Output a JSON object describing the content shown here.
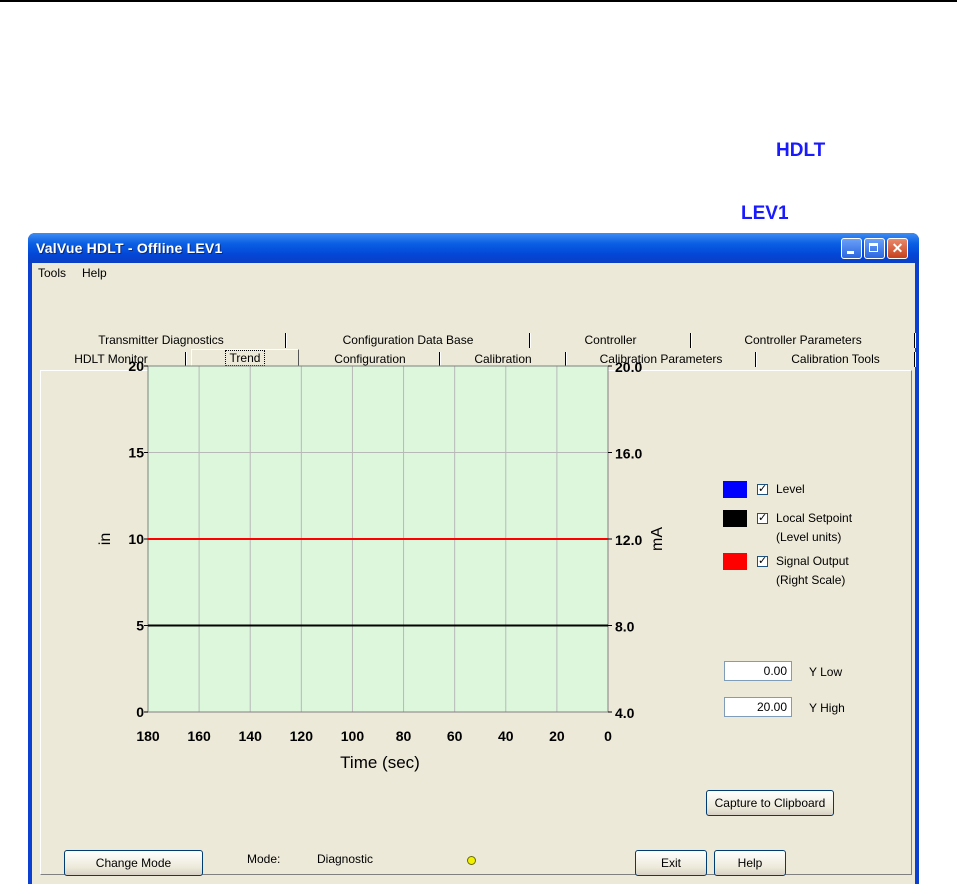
{
  "window": {
    "title": "ValVue HDLT - Offline  LEV1"
  },
  "menu": [
    "Tools",
    "Help"
  ],
  "tabs": {
    "row_back": [
      "Transmitter Diagnostics",
      "Configuration Data Base",
      "Controller",
      "Controller Parameters"
    ],
    "row_front": [
      "HDLT Monitor",
      "Trend",
      "Configuration",
      "Calibration",
      "Calibration Parameters",
      "Calibration Tools"
    ],
    "active": "Trend"
  },
  "chart_data": {
    "type": "line",
    "x": [
      180,
      160,
      140,
      120,
      100,
      80,
      60,
      40,
      20,
      0
    ],
    "xlabel": "Time (sec)",
    "ylabel": "in",
    "ylim": [
      0,
      20
    ],
    "y_ticks": [
      0,
      5,
      10,
      15,
      20
    ],
    "y2label": "mA",
    "y2lim": [
      4.0,
      20.0
    ],
    "y2_ticks": [
      "4.0",
      "8.0",
      "12.0",
      "16.0",
      "20.0"
    ],
    "grid": true,
    "background": "#ddf7dd",
    "series": [
      {
        "name": "Local Setpoint (Level units)",
        "axis": "left",
        "color": "#000000",
        "values": [
          5,
          5,
          5,
          5,
          5,
          5,
          5,
          5,
          5,
          5
        ]
      },
      {
        "name": "Signal Output (Right Scale)",
        "axis": "right",
        "color": "#ff0000",
        "values": [
          12.0,
          12.0,
          12.0,
          12.0,
          12.0,
          12.0,
          12.0,
          12.0,
          12.0,
          12.0
        ]
      }
    ]
  },
  "side": {
    "device_type": "HDLT",
    "tag": "LEV1",
    "legend": [
      {
        "color": "#0000ff",
        "checked": true,
        "line1": "Level",
        "line2": ""
      },
      {
        "color": "#000000",
        "checked": true,
        "line1": "Local Setpoint",
        "line2": "(Level units)"
      },
      {
        "color": "#ff0000",
        "checked": true,
        "line1": "Signal Output",
        "line2": "(Right Scale)"
      }
    ],
    "y_low": {
      "value": "0.00",
      "label": "Y Low"
    },
    "y_high": {
      "value": "20.00",
      "label": "Y High"
    },
    "capture_button": "Capture to Clipboard"
  },
  "statusbar": {
    "change_mode_button": "Change Mode",
    "mode_label": "Mode:",
    "mode_value": "Diagnostic",
    "exit_button": "Exit",
    "help_button": "Help",
    "indicator_color": "#f0f000"
  }
}
